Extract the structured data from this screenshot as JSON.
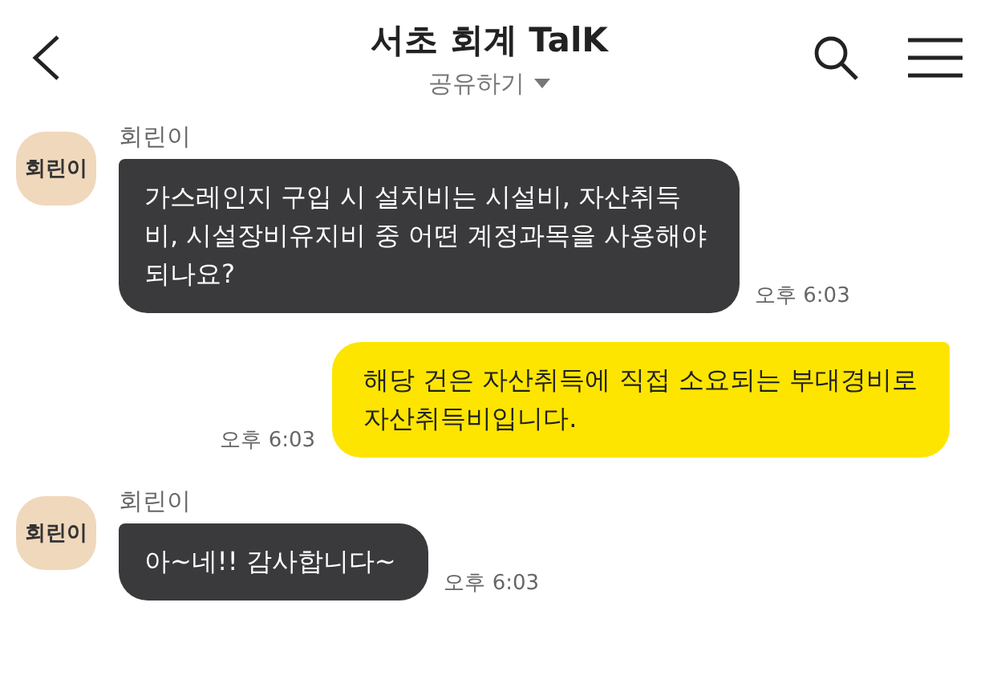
{
  "header": {
    "title": "서초 회계 TalK",
    "subtitle": "공유하기"
  },
  "messages": [
    {
      "kind": "received",
      "avatar": "회린이",
      "sender": "회린이",
      "text": "가스레인지 구입 시 설치비는 시설비, 자산취득\n비, 시설장비유지비 중 어떤 계정과목을 사용해야\n되나요?",
      "time": "오후 6:03"
    },
    {
      "kind": "sent",
      "text": "해당 건은 자산취득에 직접 소요되는 부대경비로\n자산취득비입니다.",
      "time": "오후 6:03"
    },
    {
      "kind": "received",
      "avatar": "회린이",
      "sender": "회린이",
      "text": "아~네!!  감사합니다~",
      "time": "오후 6:03"
    }
  ]
}
